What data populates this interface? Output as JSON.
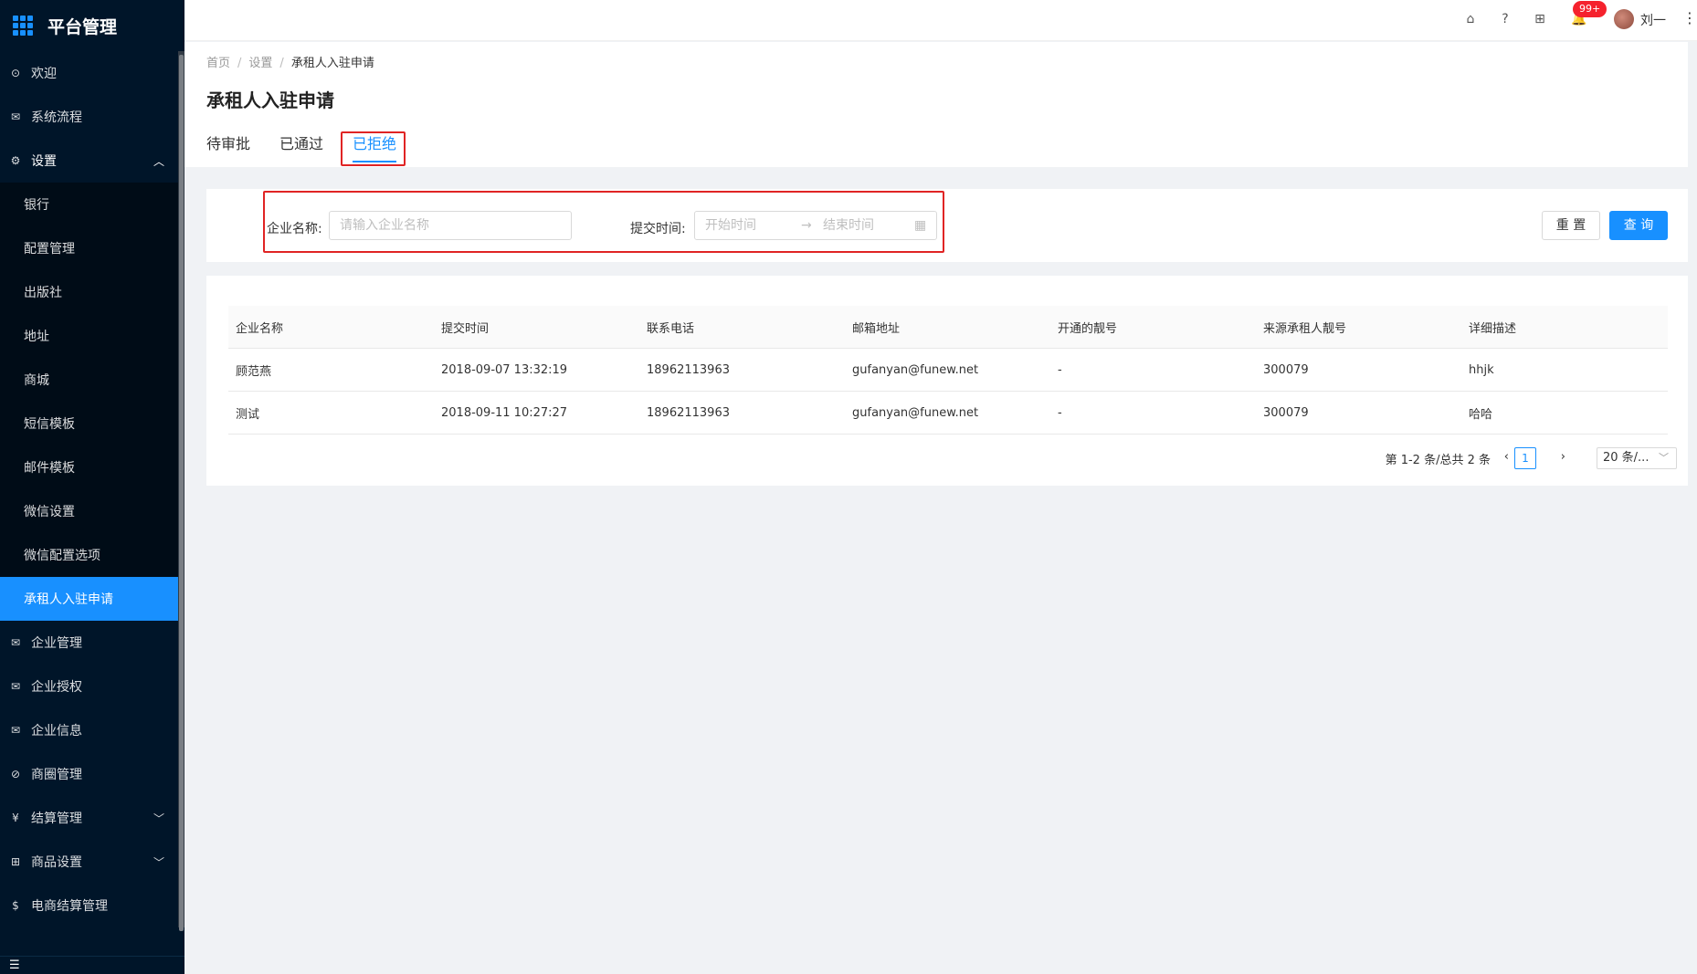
{
  "app": {
    "title": "平台管理"
  },
  "sidebar": {
    "items": [
      {
        "label": "欢迎",
        "icon": "check-circle-icon"
      },
      {
        "label": "系统流程",
        "icon": "mail-icon"
      },
      {
        "label": "设置",
        "icon": "gear-icon",
        "expanded": true
      }
    ],
    "submenu": [
      "银行",
      "配置管理",
      "出版社",
      "地址",
      "商城",
      "短信模板",
      "邮件模板",
      "微信设置",
      "微信配置选项",
      "承租人入驻申请"
    ],
    "active_submenu": "承租人入驻申请",
    "items_after": [
      {
        "label": "企业管理",
        "icon": "mail-icon"
      },
      {
        "label": "企业授权",
        "icon": "mail-icon"
      },
      {
        "label": "企业信息",
        "icon": "mail-icon"
      },
      {
        "label": "商圈管理",
        "icon": "compass-icon"
      },
      {
        "label": "结算管理",
        "icon": "yen-icon",
        "has_children": true
      },
      {
        "label": "商品设置",
        "icon": "appstore-icon",
        "has_children": true
      },
      {
        "label": "电商结算管理",
        "icon": "dollar-icon"
      }
    ]
  },
  "header": {
    "notification_badge": "99+",
    "username": "刘一"
  },
  "breadcrumb": [
    "首页",
    "设置",
    "承租人入驻申请"
  ],
  "page_title": "承租人入驻申请",
  "tabs": [
    "待审批",
    "已通过",
    "已拒绝"
  ],
  "active_tab": "已拒绝",
  "search": {
    "company_label": "企业名称:",
    "company_placeholder": "请输入企业名称",
    "time_label": "提交时间:",
    "start_placeholder": "开始时间",
    "end_placeholder": "结束时间",
    "reset_label": "重 置",
    "query_label": "查 询"
  },
  "table": {
    "columns": [
      "企业名称",
      "提交时间",
      "联系电话",
      "邮箱地址",
      "开通的靓号",
      "来源承租人靓号",
      "详细描述"
    ],
    "rows": [
      [
        "顾范燕",
        "2018-09-07 13:32:19",
        "18962113963",
        "gufanyan@funew.net",
        "-",
        "300079",
        "hhjk"
      ],
      [
        "测试",
        "2018-09-11 10:27:27",
        "18962113963",
        "gufanyan@funew.net",
        "-",
        "300079",
        "哈哈"
      ]
    ]
  },
  "pagination": {
    "summary": "第 1-2 条/总共 2 条",
    "current": "1",
    "page_size": "20 条/..."
  },
  "colors": {
    "accent": "#1890ff",
    "sidebar_bg": "#001529",
    "highlight": "#e02424"
  }
}
